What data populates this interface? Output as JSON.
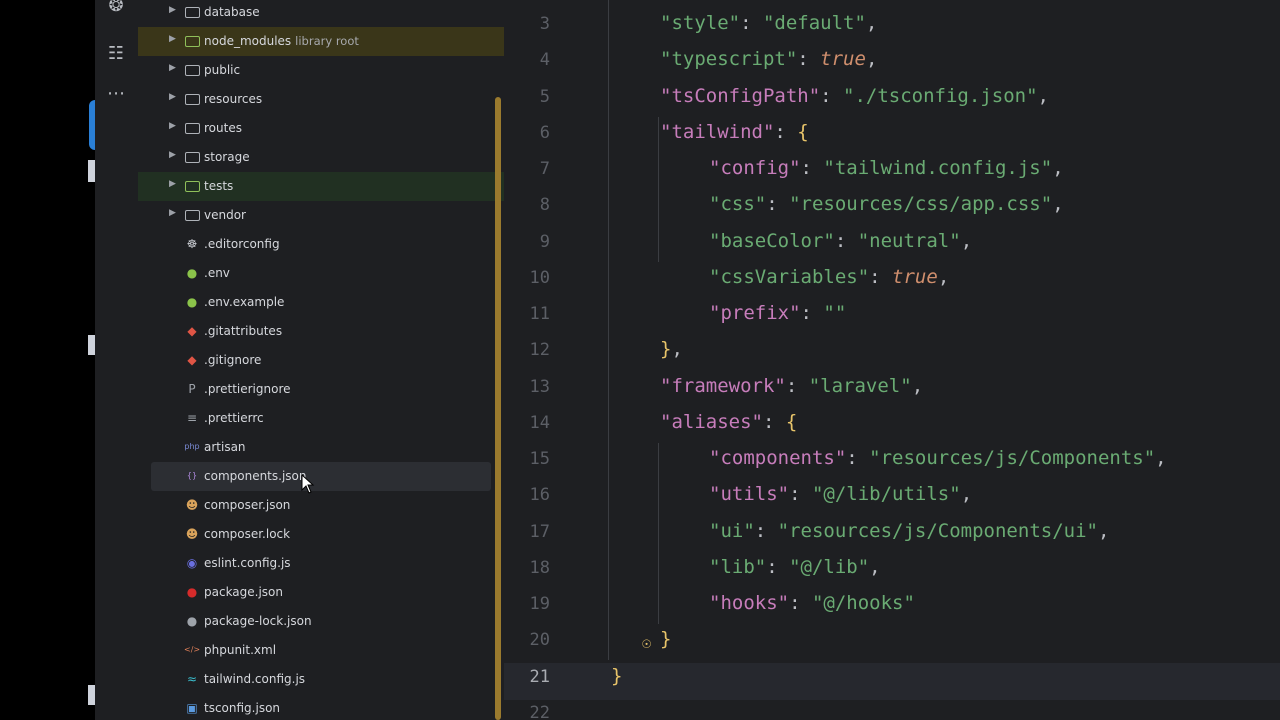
{
  "tree": [
    {
      "id": "database",
      "label": "database",
      "type": "folder"
    },
    {
      "id": "node-modules",
      "label": "node_modules",
      "sub": "library root",
      "type": "folder",
      "hl": "olive"
    },
    {
      "id": "public",
      "label": "public",
      "type": "folder"
    },
    {
      "id": "resources",
      "label": "resources",
      "type": "folder"
    },
    {
      "id": "routes",
      "label": "routes",
      "type": "folder"
    },
    {
      "id": "storage",
      "label": "storage",
      "type": "folder"
    },
    {
      "id": "tests",
      "label": "tests",
      "type": "folder",
      "hl": "green"
    },
    {
      "id": "vendor",
      "label": "vendor",
      "type": "folder"
    },
    {
      "id": "editorconfig",
      "label": ".editorconfig",
      "type": "file",
      "icon": "editorconfig-icon",
      "glyph": "☸",
      "color": "#c9ccd2"
    },
    {
      "id": "env",
      "label": ".env",
      "type": "file",
      "icon": "env-icon",
      "glyph": "●",
      "color": "#8bc34a"
    },
    {
      "id": "env-example",
      "label": ".env.example",
      "type": "file",
      "icon": "env-icon",
      "glyph": "●",
      "color": "#8bc34a"
    },
    {
      "id": "gitattributes",
      "label": ".gitattributes",
      "type": "file",
      "icon": "git-icon",
      "glyph": "◆",
      "color": "#e05545"
    },
    {
      "id": "gitignore",
      "label": ".gitignore",
      "type": "file",
      "icon": "git-icon",
      "glyph": "◆",
      "color": "#e05545"
    },
    {
      "id": "prettierignore",
      "label": ".prettierignore",
      "type": "file",
      "icon": "prettier-icon",
      "glyph": "P",
      "color": "#9ea3aa"
    },
    {
      "id": "prettierrc",
      "label": ".prettierrc",
      "type": "file",
      "icon": "prettier-icon",
      "glyph": "≡",
      "color": "#9ea3aa"
    },
    {
      "id": "artisan",
      "label": "artisan",
      "type": "file",
      "icon": "php-icon",
      "glyph": "php",
      "color": "#7b8bd6"
    },
    {
      "id": "components-json",
      "label": "components.json",
      "type": "file",
      "icon": "json-icon",
      "glyph": "{}",
      "color": "#b08be0",
      "selected": true
    },
    {
      "id": "composer-json",
      "label": "composer.json",
      "type": "file",
      "icon": "composer-icon",
      "glyph": "☻",
      "color": "#d9a35b"
    },
    {
      "id": "composer-lock",
      "label": "composer.lock",
      "type": "file",
      "icon": "composer-icon",
      "glyph": "☻",
      "color": "#d9a35b"
    },
    {
      "id": "eslint",
      "label": "eslint.config.js",
      "type": "file",
      "icon": "eslint-icon",
      "glyph": "◉",
      "color": "#6a6fe0"
    },
    {
      "id": "package-json",
      "label": "package.json",
      "type": "file",
      "icon": "npm-icon",
      "glyph": "●",
      "color": "#d62b2b"
    },
    {
      "id": "package-lock",
      "label": "package-lock.json",
      "type": "file",
      "icon": "npm-icon",
      "glyph": "●",
      "color": "#9ea3aa"
    },
    {
      "id": "phpunit",
      "label": "phpunit.xml",
      "type": "file",
      "icon": "xml-icon",
      "glyph": "</>",
      "color": "#e0805a"
    },
    {
      "id": "tailwind",
      "label": "tailwind.config.js",
      "type": "file",
      "icon": "tailwind-icon",
      "glyph": "≈",
      "color": "#3bc0d0"
    },
    {
      "id": "tsconfig",
      "label": "tsconfig.json",
      "type": "file",
      "icon": "ts-icon",
      "glyph": "▣",
      "color": "#5b9be0"
    }
  ],
  "code": [
    {
      "n": "3",
      "indent": 1,
      "tokens": [
        [
          "s",
          "\"style\""
        ],
        [
          "p",
          ": "
        ],
        [
          "s",
          "\"default\""
        ],
        [
          "p",
          ","
        ]
      ]
    },
    {
      "n": "4",
      "indent": 1,
      "tokens": [
        [
          "s",
          "\"typescript\""
        ],
        [
          "p",
          ": "
        ],
        [
          "kw",
          "true"
        ],
        [
          "p",
          ","
        ]
      ]
    },
    {
      "n": "5",
      "indent": 1,
      "tokens": [
        [
          "k",
          "\"tsConfigPath\""
        ],
        [
          "p",
          ": "
        ],
        [
          "s",
          "\"./tsconfig.json\""
        ],
        [
          "p",
          ","
        ]
      ]
    },
    {
      "n": "6",
      "indent": 1,
      "tokens": [
        [
          "k",
          "\"tailwind\""
        ],
        [
          "p",
          ": "
        ],
        [
          "b1",
          "{"
        ]
      ]
    },
    {
      "n": "7",
      "indent": 2,
      "tokens": [
        [
          "k",
          "\"config\""
        ],
        [
          "p",
          ": "
        ],
        [
          "s",
          "\"tailwind.config.js\""
        ],
        [
          "p",
          ","
        ]
      ]
    },
    {
      "n": "8",
      "indent": 2,
      "tokens": [
        [
          "s",
          "\"css\""
        ],
        [
          "p",
          ": "
        ],
        [
          "s",
          "\"resources/css/app.css\""
        ],
        [
          "p",
          ","
        ]
      ]
    },
    {
      "n": "9",
      "indent": 2,
      "tokens": [
        [
          "s",
          "\"baseColor\""
        ],
        [
          "p",
          ": "
        ],
        [
          "s",
          "\"neutral\""
        ],
        [
          "p",
          ","
        ]
      ]
    },
    {
      "n": "10",
      "indent": 2,
      "tokens": [
        [
          "s",
          "\"cssVariables\""
        ],
        [
          "p",
          ": "
        ],
        [
          "kw",
          "true"
        ],
        [
          "p",
          ","
        ]
      ]
    },
    {
      "n": "11",
      "indent": 2,
      "tokens": [
        [
          "k",
          "\"prefix\""
        ],
        [
          "p",
          ": "
        ],
        [
          "s",
          "\"\""
        ]
      ]
    },
    {
      "n": "12",
      "indent": 1,
      "tokens": [
        [
          "b1",
          "}"
        ],
        [
          "p",
          ","
        ]
      ]
    },
    {
      "n": "13",
      "indent": 1,
      "tokens": [
        [
          "k",
          "\"framework\""
        ],
        [
          "p",
          ": "
        ],
        [
          "s",
          "\"laravel\""
        ],
        [
          "p",
          ","
        ]
      ]
    },
    {
      "n": "14",
      "indent": 1,
      "tokens": [
        [
          "k",
          "\"aliases\""
        ],
        [
          "p",
          ": "
        ],
        [
          "b1",
          "{"
        ]
      ]
    },
    {
      "n": "15",
      "indent": 2,
      "tokens": [
        [
          "k",
          "\"components\""
        ],
        [
          "p",
          ": "
        ],
        [
          "s",
          "\"resources/js/Components\""
        ],
        [
          "p",
          ","
        ]
      ]
    },
    {
      "n": "16",
      "indent": 2,
      "tokens": [
        [
          "k",
          "\"utils\""
        ],
        [
          "p",
          ": "
        ],
        [
          "s",
          "\"@/lib/utils\""
        ],
        [
          "p",
          ","
        ]
      ]
    },
    {
      "n": "17",
      "indent": 2,
      "tokens": [
        [
          "s",
          "\"ui\""
        ],
        [
          "p",
          ": "
        ],
        [
          "s",
          "\"resources/js/Components/ui\""
        ],
        [
          "p",
          ","
        ]
      ]
    },
    {
      "n": "18",
      "indent": 2,
      "tokens": [
        [
          "s",
          "\"lib\""
        ],
        [
          "p",
          ": "
        ],
        [
          "s",
          "\"@/lib\""
        ],
        [
          "p",
          ","
        ]
      ]
    },
    {
      "n": "19",
      "indent": 2,
      "tokens": [
        [
          "k",
          "\"hooks\""
        ],
        [
          "p",
          ": "
        ],
        [
          "s",
          "\"@/hooks\""
        ]
      ]
    },
    {
      "n": "20",
      "indent": 1,
      "tokens": [
        [
          "b1",
          "}"
        ]
      ]
    },
    {
      "n": "21",
      "indent": 0,
      "tokens": [
        [
          "b1",
          "}"
        ]
      ]
    },
    {
      "n": "22",
      "indent": 0,
      "tokens": []
    }
  ],
  "activity": [
    "git-icon",
    "structure-icon",
    "more-icon"
  ]
}
